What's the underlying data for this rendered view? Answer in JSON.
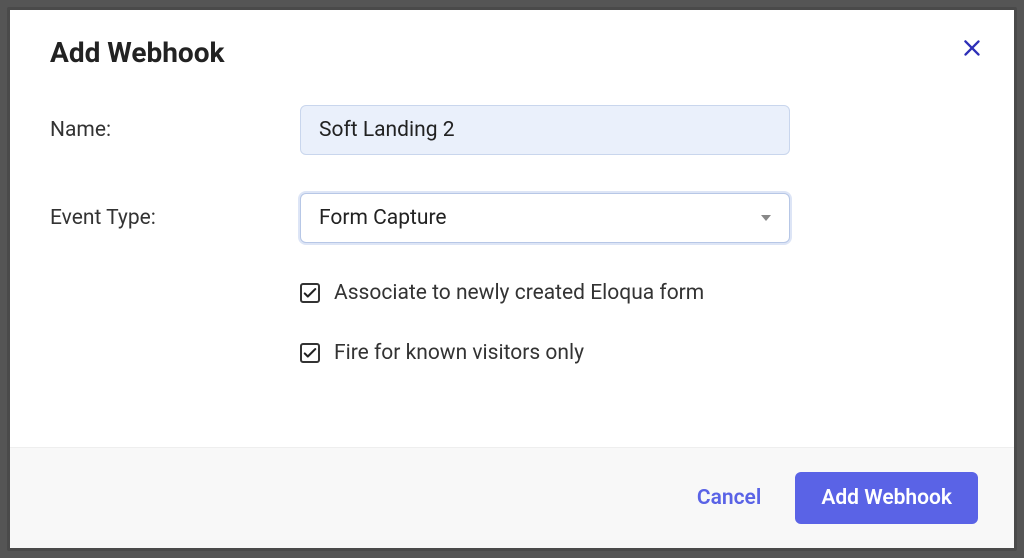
{
  "modal": {
    "title": "Add Webhook",
    "fields": {
      "name": {
        "label": "Name:",
        "value": "Soft Landing 2"
      },
      "event_type": {
        "label": "Event Type:",
        "value": "Form Capture"
      }
    },
    "checkboxes": {
      "associate": {
        "label": "Associate to newly created Eloqua form",
        "checked": true
      },
      "fire_known": {
        "label": "Fire for known visitors only",
        "checked": true
      }
    },
    "footer": {
      "cancel": "Cancel",
      "submit": "Add Webhook"
    }
  }
}
